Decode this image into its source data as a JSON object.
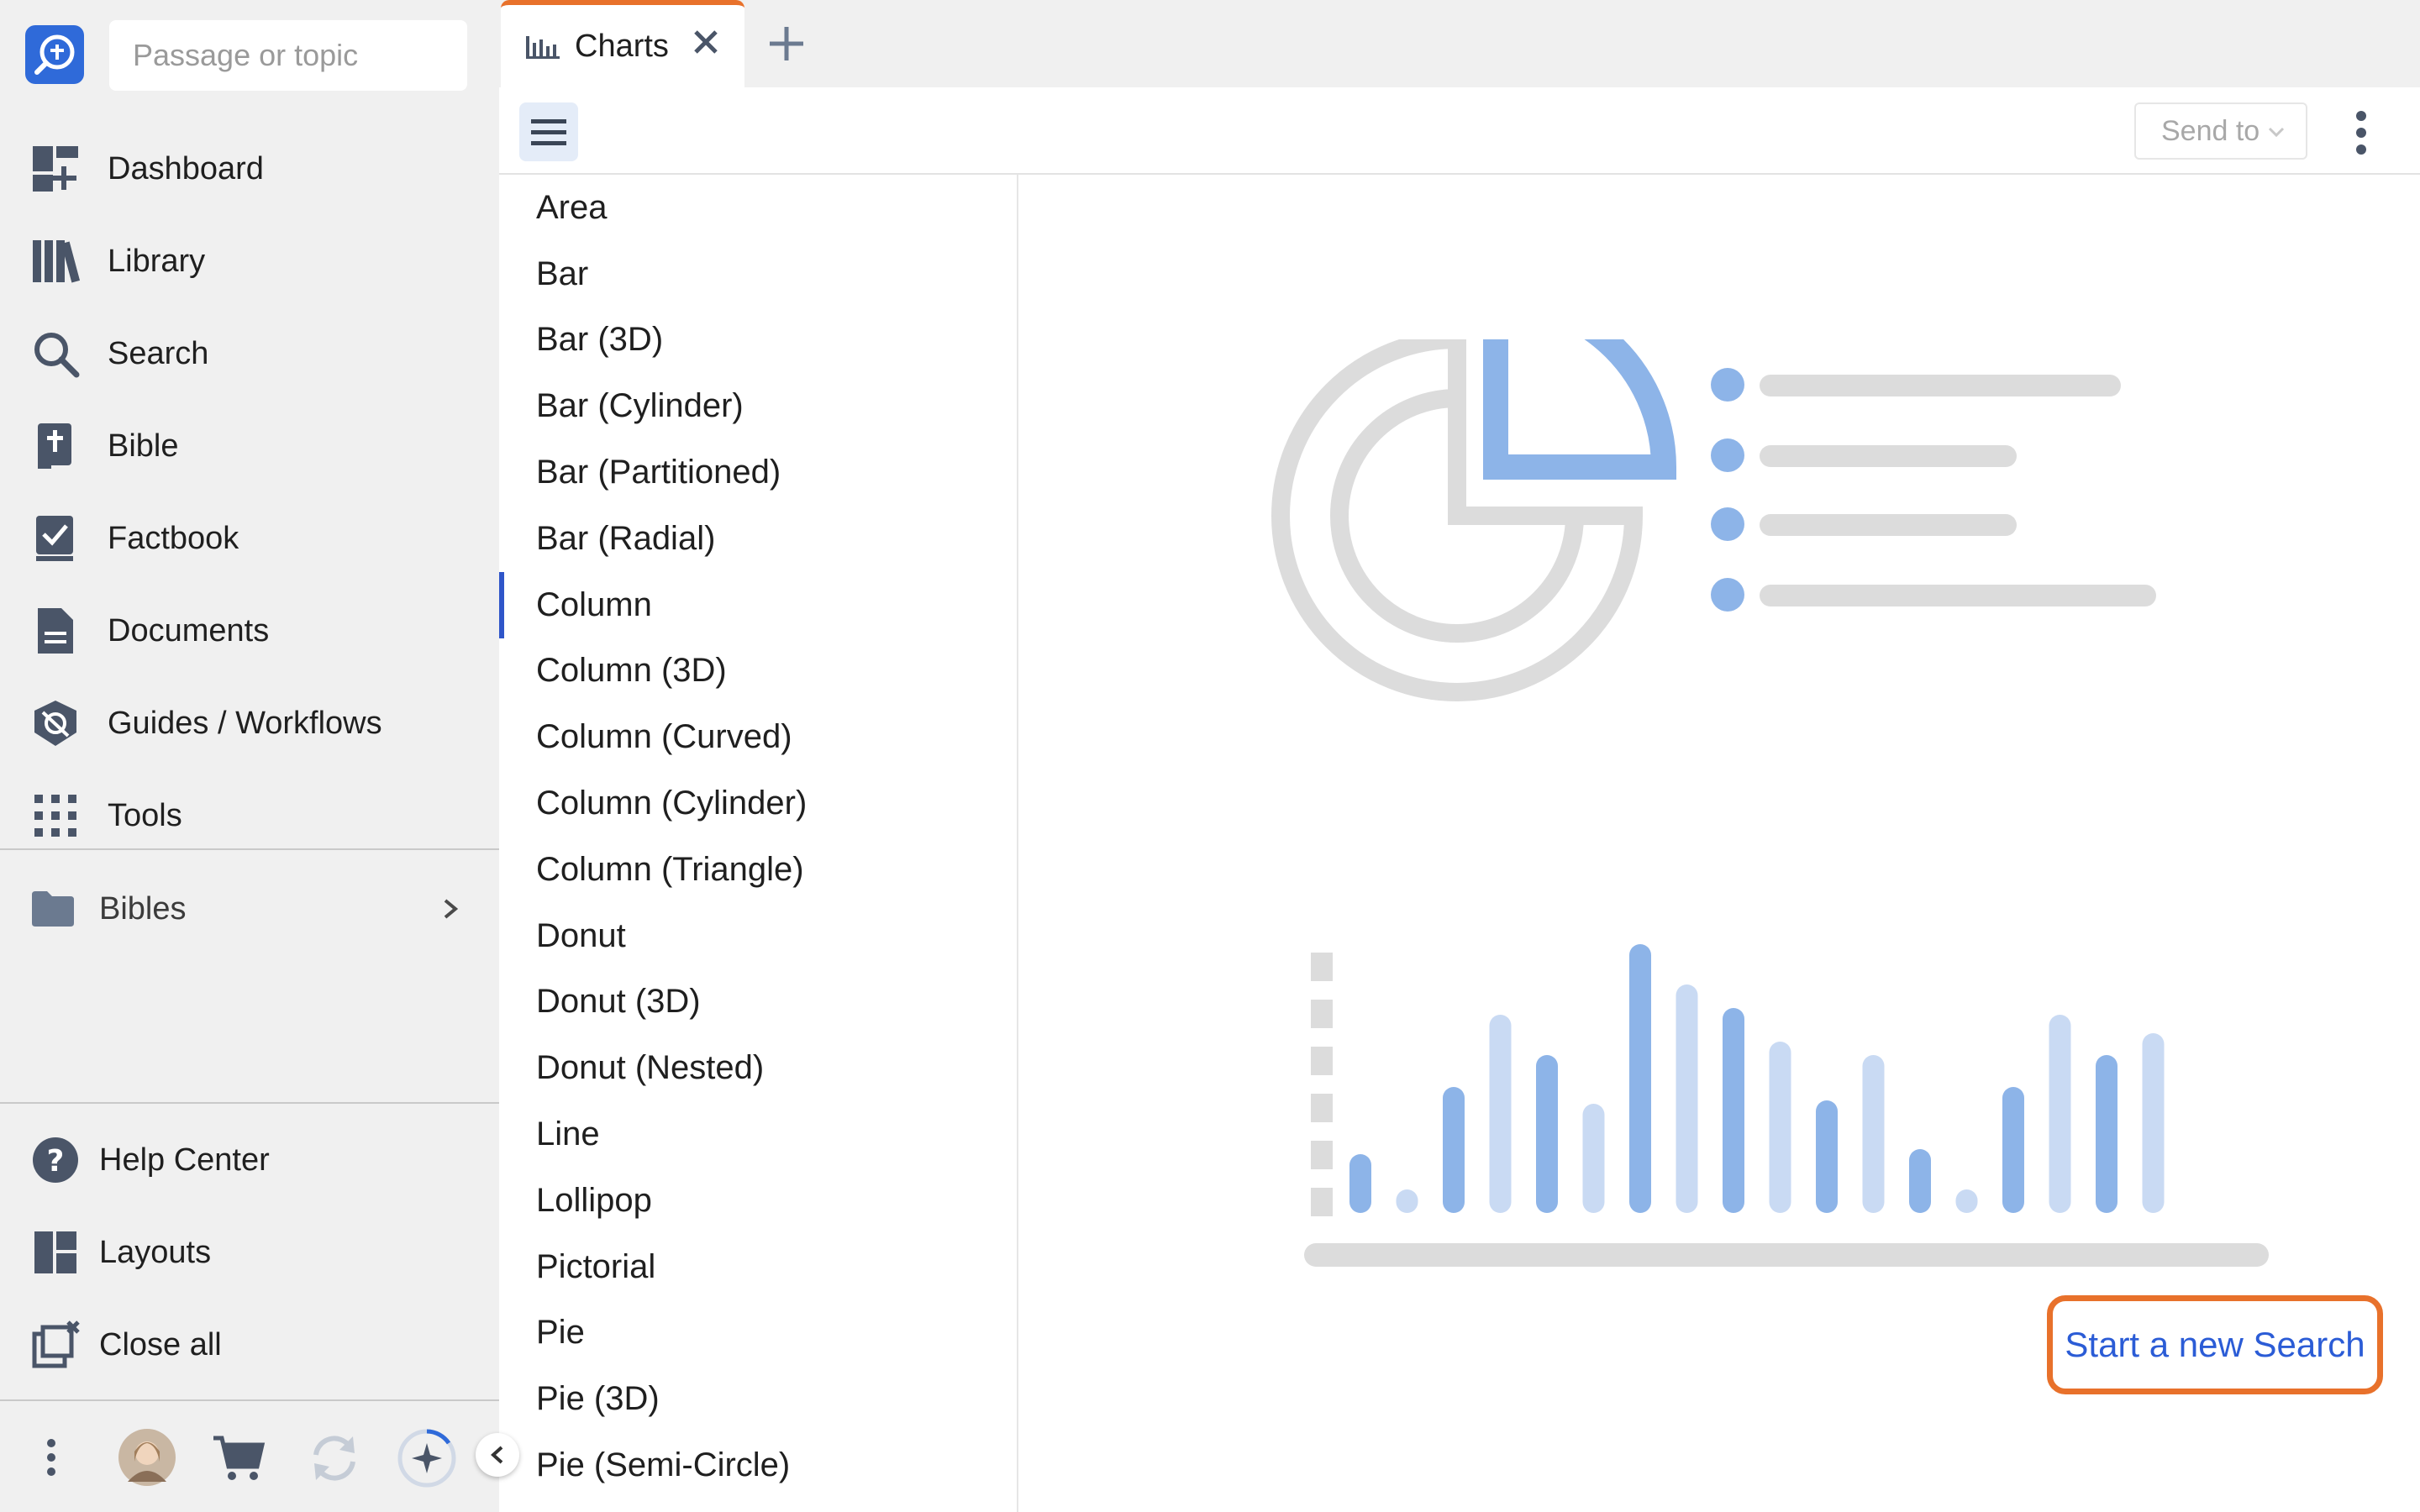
{
  "search": {
    "placeholder": "Passage or topic"
  },
  "nav": {
    "items": [
      {
        "label": "Dashboard",
        "icon": "dashboard-icon"
      },
      {
        "label": "Library",
        "icon": "library-icon"
      },
      {
        "label": "Search",
        "icon": "search-icon"
      },
      {
        "label": "Bible",
        "icon": "bible-icon"
      },
      {
        "label": "Factbook",
        "icon": "factbook-icon"
      },
      {
        "label": "Documents",
        "icon": "documents-icon"
      },
      {
        "label": "Guides / Workflows",
        "icon": "guides-icon"
      },
      {
        "label": "Tools",
        "icon": "tools-icon"
      }
    ],
    "folder": {
      "label": "Bibles",
      "icon": "folder-icon"
    },
    "bottom": [
      {
        "label": "Help Center",
        "icon": "help-icon"
      },
      {
        "label": "Layouts",
        "icon": "layouts-icon"
      },
      {
        "label": "Close all",
        "icon": "close-all-icon"
      }
    ]
  },
  "tab": {
    "label": "Charts",
    "icon": "chart-tab-icon"
  },
  "toolbar": {
    "send_to_label": "Send to"
  },
  "chart_types": {
    "items": [
      "Area",
      "Bar",
      "Bar (3D)",
      "Bar (Cylinder)",
      "Bar (Partitioned)",
      "Bar (Radial)",
      "Column",
      "Column (3D)",
      "Column (Curved)",
      "Column (Cylinder)",
      "Column (Triangle)",
      "Donut",
      "Donut (3D)",
      "Donut (Nested)",
      "Line",
      "Lollipop",
      "Pictorial",
      "Pie",
      "Pie (3D)",
      "Pie (Semi-Circle)"
    ],
    "selected": "Column"
  },
  "empty_state": {
    "action_label": "Start a new Search"
  },
  "colors": {
    "accent": "#e8712b",
    "brand": "#2f6ad9",
    "link": "#2b5cd6",
    "illus_blue": "#8db4e8",
    "illus_light_blue": "#c9daf3",
    "illus_gray": "#dcdcdc"
  }
}
